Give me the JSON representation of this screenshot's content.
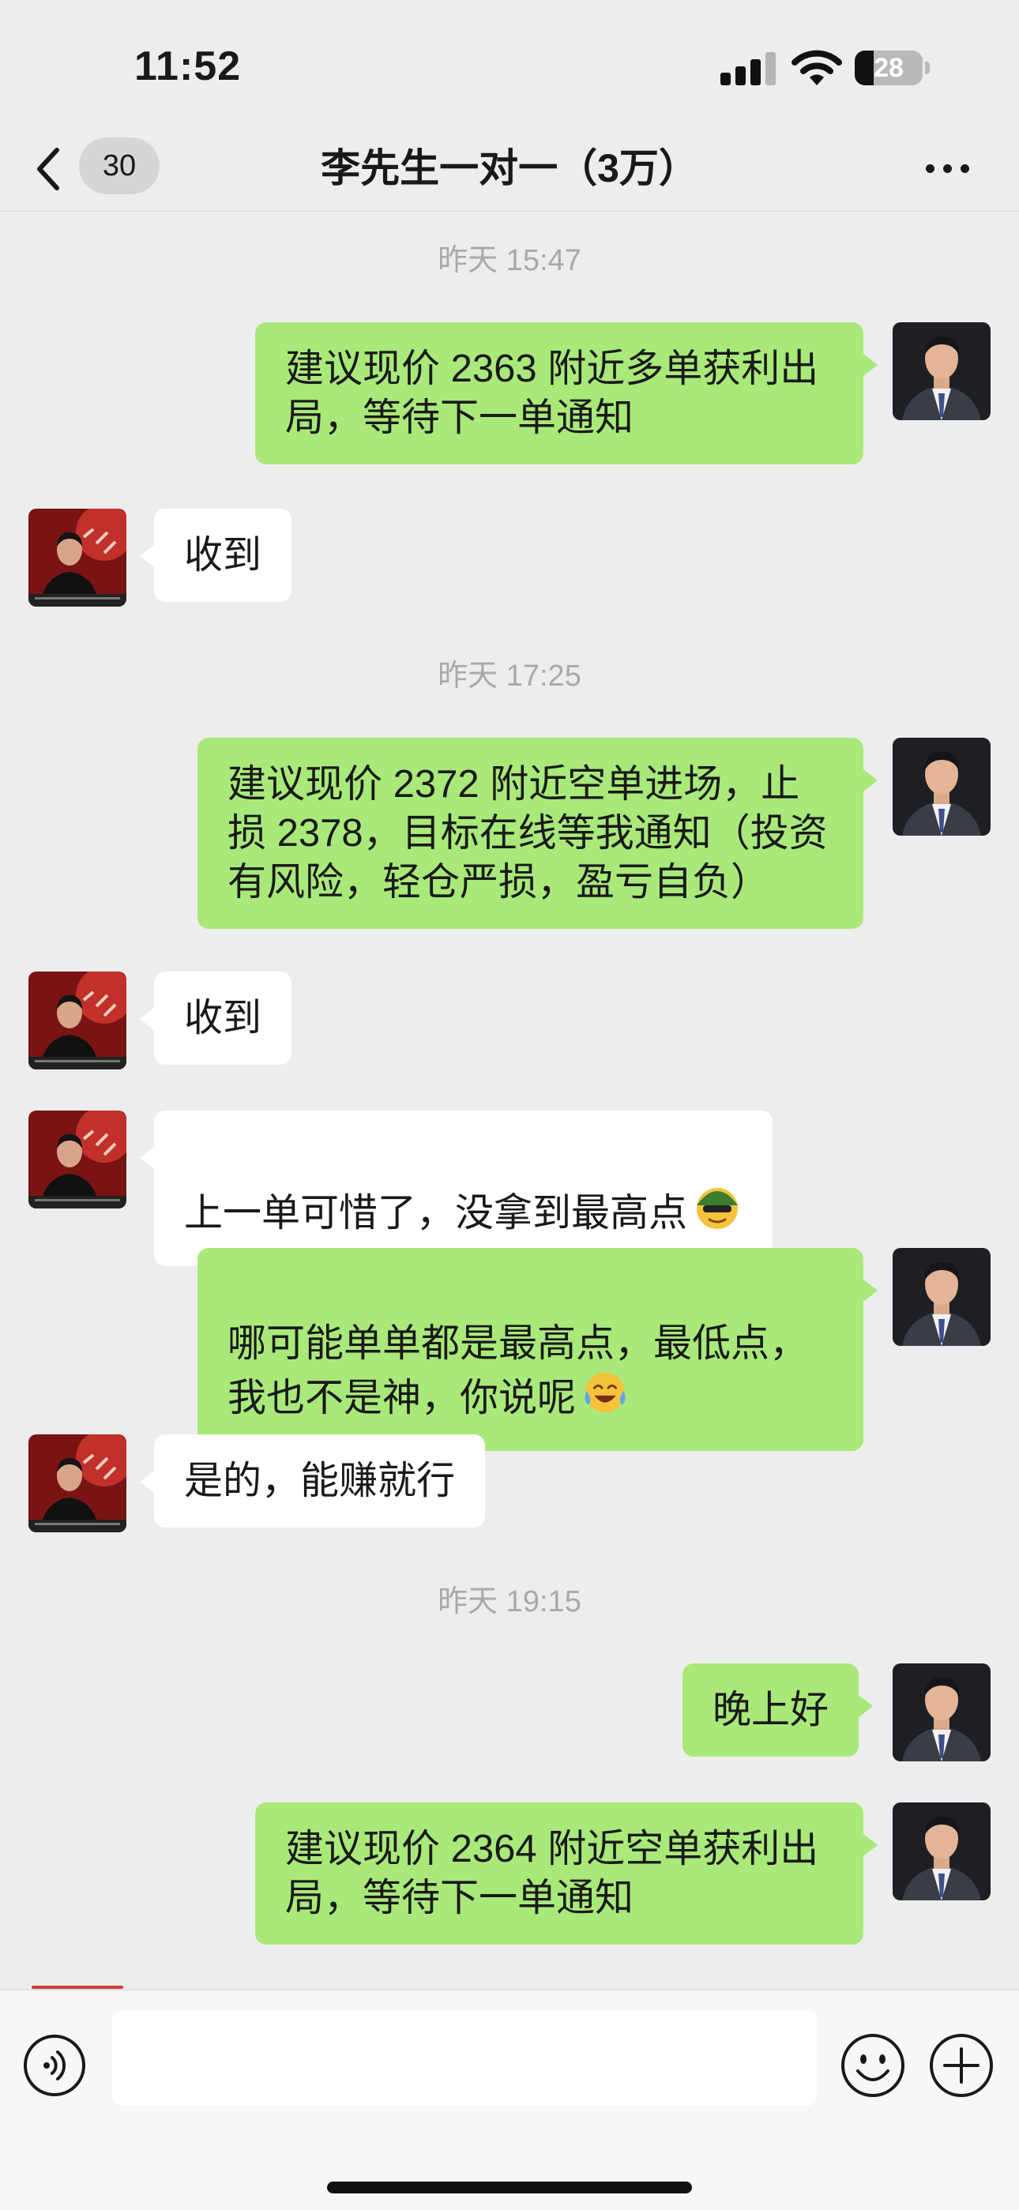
{
  "status_bar": {
    "time": "11:52",
    "battery_level": "28",
    "battery_fraction": 0.28
  },
  "nav": {
    "unread_count": "30",
    "title": "李先生一对一（3万）"
  },
  "chat": {
    "timestamps": [
      "昨天 15:47",
      "昨天 17:25",
      "昨天 19:15"
    ],
    "messages": [
      {
        "side": "out",
        "text": "建议现价 2363 附近多单获利出局，等待下一单通知"
      },
      {
        "side": "in",
        "text": "收到"
      },
      {
        "side": "out",
        "text": "建议现价 2372 附近空单进场，止损 2378，目标在线等我通知（投资有风险，轻仓严损，盈亏自负）"
      },
      {
        "side": "in",
        "text": "收到"
      },
      {
        "side": "in",
        "text": "上一单可惜了，没拿到最高点",
        "emoji": "cool-face-emoji"
      },
      {
        "side": "out",
        "text": "哪可能单单都是最高点，最低点，我也不是神，你说呢",
        "emoji": "laughing-tears-emoji"
      },
      {
        "side": "in",
        "text": "是的，能赚就行"
      },
      {
        "side": "out",
        "text": "晚上好"
      },
      {
        "side": "out",
        "text": "建议现价 2364 附近空单获利出局，等待下一单通知"
      }
    ]
  },
  "input_bar": {
    "message_value": "",
    "icons": [
      "voice-icon",
      "emoji-icon",
      "plus-icon"
    ]
  },
  "colors": {
    "outgoing_bubble": "#a9e97a",
    "incoming_bubble": "#ffffff",
    "background": "#ededed",
    "timestamp": "#a9a9a9"
  }
}
